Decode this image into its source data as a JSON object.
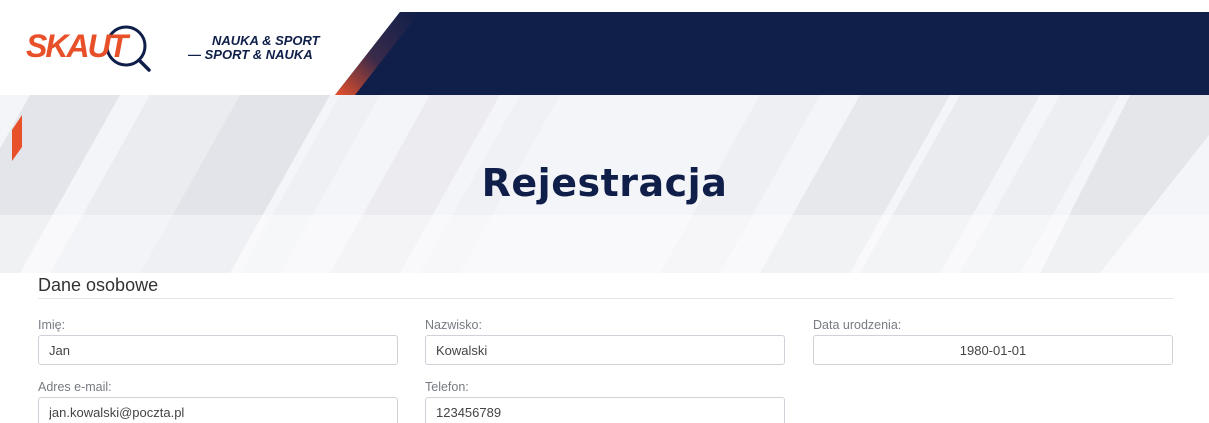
{
  "header": {
    "logo_skaut": "SKAUT",
    "logo_ns_line1": "NAUKA & SPORT",
    "logo_ns_line2": "— SPORT & NAUKA",
    "colors": {
      "navy": "#0f1f4a",
      "orange": "#e8502a"
    }
  },
  "hero": {
    "title": "Rejestracja"
  },
  "form": {
    "section_title": "Dane osobowe",
    "fields": {
      "first_name": {
        "label": "Imię:",
        "value": "Jan"
      },
      "last_name": {
        "label": "Nazwisko:",
        "value": "Kowalski"
      },
      "birth_date": {
        "label": "Data urodzenia:",
        "value": "1980-01-01"
      },
      "email": {
        "label": "Adres e-mail:",
        "value": "jan.kowalski@poczta.pl"
      },
      "phone": {
        "label": "Telefon:",
        "value": "123456789"
      }
    }
  }
}
